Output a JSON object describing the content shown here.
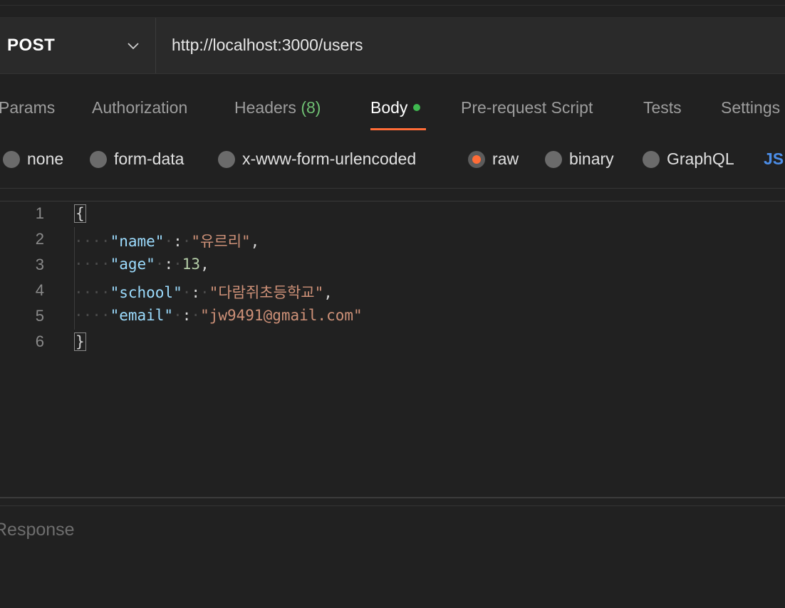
{
  "request": {
    "method": "POST",
    "url": "http://localhost:3000/users"
  },
  "tabs": [
    {
      "label": "Params"
    },
    {
      "label": "Authorization"
    },
    {
      "label": "Headers",
      "count": "(8)"
    },
    {
      "label": "Body",
      "active": true,
      "indicator": "green-dot"
    },
    {
      "label": "Pre-request Script"
    },
    {
      "label": "Tests"
    },
    {
      "label": "Settings"
    }
  ],
  "body_types": {
    "options": [
      "none",
      "form-data",
      "x-www-form-urlencoded",
      "raw",
      "binary",
      "GraphQL"
    ],
    "selected": "raw",
    "format": "JS"
  },
  "editor": {
    "line_numbers": [
      "1",
      "2",
      "3",
      "4",
      "5",
      "6"
    ],
    "json": {
      "open": "{",
      "close": "}",
      "name_key": "\"name\"",
      "name_val": "\"유르리\"",
      "age_key": "\"age\"",
      "age_val": "13",
      "school_key": "\"school\"",
      "school_val": "\"다람쥐초등학교\"",
      "email_key": "\"email\"",
      "email_val": "\"jw9491@gmail.com\""
    }
  },
  "response": {
    "label": "Response"
  },
  "colors": {
    "accent": "#ff6c37",
    "active_dot": "#3fb950",
    "link": "#4c8ee8",
    "background": "#212121"
  }
}
